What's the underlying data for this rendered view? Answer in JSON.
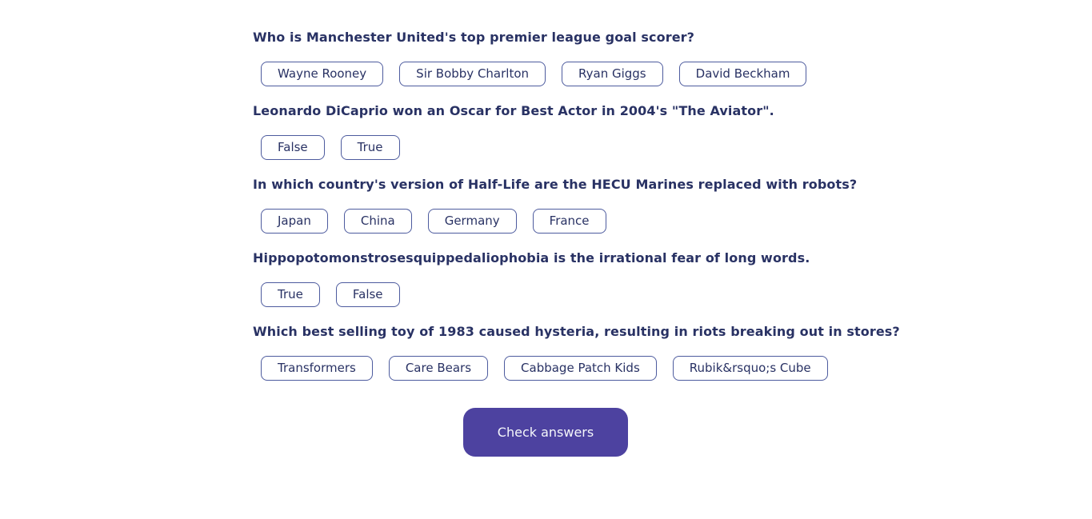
{
  "colors": {
    "text": "#293264",
    "answer_border": "#4d5b9e",
    "button_bg": "#4d42a0",
    "button_text": "#f5f7fb",
    "background": "#ffffff"
  },
  "questions": [
    {
      "text": "Who is Manchester United's top premier league goal scorer?",
      "answers": [
        "Wayne Rooney",
        "Sir Bobby Charlton",
        "Ryan Giggs",
        "David Beckham"
      ]
    },
    {
      "text": "Leonardo DiCaprio won an Oscar for Best Actor in 2004's \"The Aviator\".",
      "answers": [
        "False",
        "True"
      ]
    },
    {
      "text": "In which country's version of Half-Life are the HECU Marines replaced with robots?",
      "answers": [
        "Japan",
        "China",
        "Germany",
        "France"
      ]
    },
    {
      "text": "Hippopotomonstrosesquippedaliophobia is the irrational fear of long words.",
      "answers": [
        "True",
        "False"
      ]
    },
    {
      "text": "Which best selling toy of 1983 caused hysteria, resulting in riots breaking out in stores?",
      "answers": [
        "Transformers",
        "Care Bears",
        "Cabbage Patch Kids",
        "Rubik&rsquo;s Cube"
      ]
    }
  ],
  "check_button_label": "Check answers"
}
